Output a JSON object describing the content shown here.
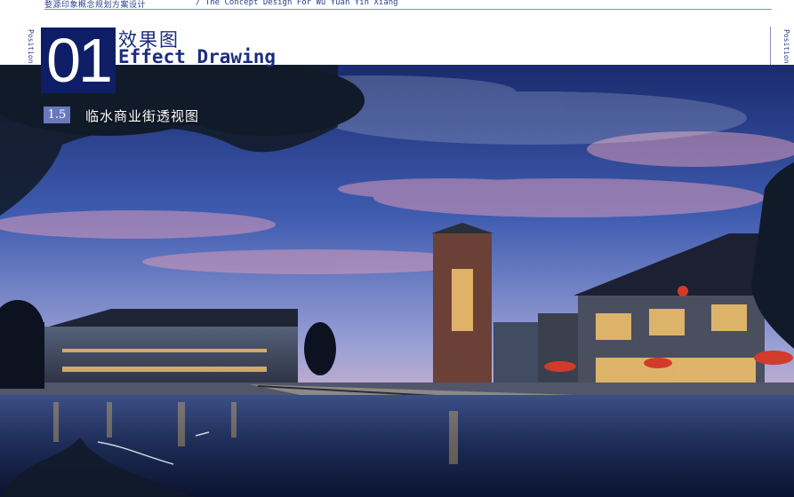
{
  "header": {
    "project_cn": "婺源印象概念规划方案设计",
    "project_en": "/ The Concept Design For Wu Yuan Yin Xiang",
    "side_left": "Position|",
    "side_right": "Position|Plan Design|Implement",
    "chapter_number": "01",
    "title_cn": "效果图",
    "title_en": "Effect Drawing"
  },
  "section": {
    "badge": "1.5",
    "caption": "临水商业街透视图"
  },
  "colors": {
    "brand_navy": "#0e1e66",
    "title_blue": "#1b2d7e",
    "badge_blue": "#6979c0"
  }
}
